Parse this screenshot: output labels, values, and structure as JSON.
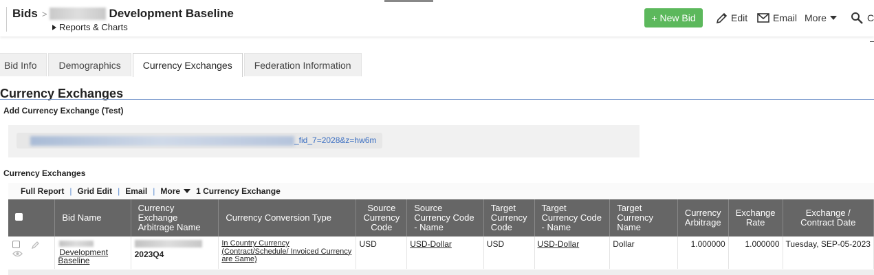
{
  "header": {
    "breadcrumb_root": "Bids",
    "breadcrumb_separator": ">",
    "record_title": "Development Baseline",
    "reports_link": "Reports & Charts",
    "new_bid_label": "+ New Bid",
    "edit_label": "Edit",
    "email_label": "Email",
    "more_label": "More",
    "customize_label": "Cu",
    "accent_color": "#5cb85c"
  },
  "tabs": [
    {
      "label": "Bid Info",
      "active": false
    },
    {
      "label": "Demographics",
      "active": false
    },
    {
      "label": "Currency Exchanges",
      "active": true
    },
    {
      "label": "Federation Information",
      "active": false
    }
  ],
  "section": {
    "title": "Currency Exchanges",
    "add_label": "Add Currency Exchange (Test)",
    "url_tail": "_fid_7=2028&z=hw6m",
    "report_label": "Currency Exchanges"
  },
  "report_toolbar": {
    "full_report": "Full Report",
    "grid_edit": "Grid Edit",
    "email": "Email",
    "more": "More",
    "count": "1 Currency Exchange"
  },
  "table": {
    "columns": [
      "Bid Name",
      "Currency Exchange Arbitrage Name",
      "Currency Conversion Type",
      "Source Currency Code",
      "Source Currency Code - Name",
      "Target Currency Code",
      "Target Currency Code - Name",
      "Target Currency Name",
      "Currency Arbitrage",
      "Exchange Rate",
      "Exchange / Contract Date"
    ],
    "rows": [
      {
        "bid_name": "Development Baseline",
        "arbitrage_name": "2023Q4",
        "conversion_type": "In Country Currency (Contract/Schedule/ Invoiced Currency are Same)",
        "source_code": "USD",
        "source_code_name": "USD-Dollar",
        "target_code": "USD",
        "target_code_name": "USD-Dollar",
        "target_name": "Dollar",
        "arbitrage": "1.000000",
        "exchange_rate": "1.000000",
        "contract_date": "Tuesday, SEP-05-2023"
      }
    ]
  }
}
